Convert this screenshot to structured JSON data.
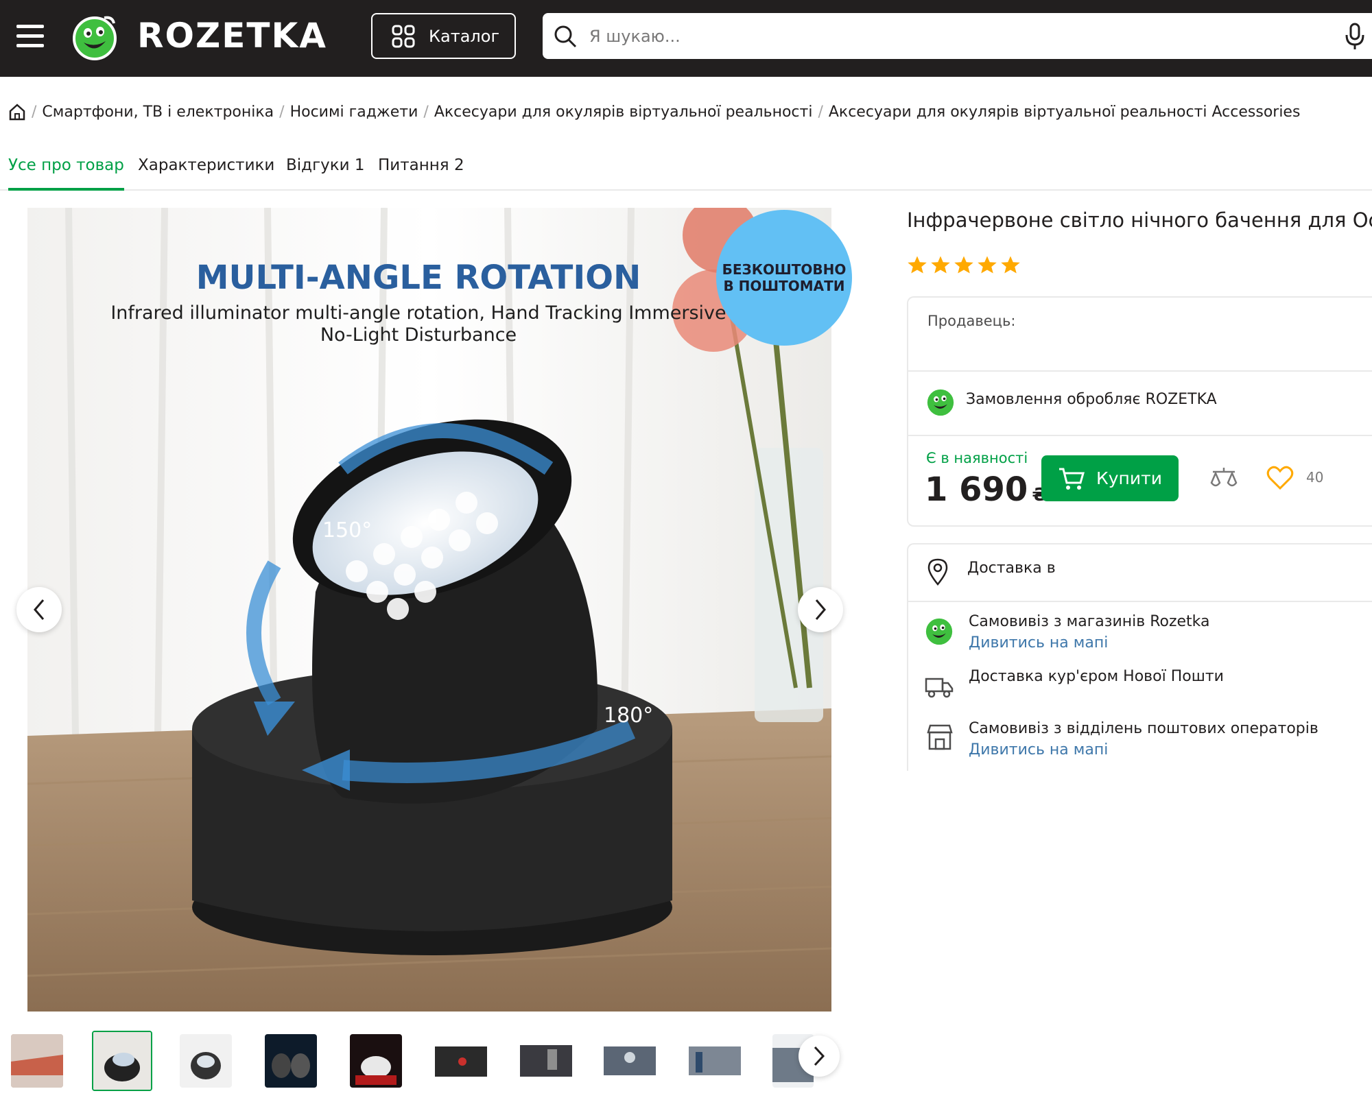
{
  "header": {
    "logo_text": "ROZETKA",
    "catalog_label": "Каталог",
    "search_placeholder": "Я шукаю..."
  },
  "breadcrumbs": [
    "Смартфони, ТВ і електроніка",
    "Носимі гаджети",
    "Аксесуари для окулярів віртуальної реальності",
    "Аксесуари для окулярів віртуальної реальності Accessories"
  ],
  "tabs": [
    "Усе про товар",
    "Характеристики",
    "Відгуки 1",
    "Питання 2"
  ],
  "gallery": {
    "headline": "MULTI-ANGLE ROTATION",
    "subline1": "Infrared illuminator multi-angle rotation, Hand Tracking Immersive",
    "subline2": "No-Light Disturbance",
    "angle1": "150°",
    "angle2": "180°",
    "badge_line1": "БЕЗКОШТОВНО",
    "badge_line2": "В ПОШТОМАТИ",
    "thumb_count": 10,
    "active_thumb": 2
  },
  "product": {
    "title": "Інфрачервоне світло нічного бачення для Oculus",
    "rating": 5,
    "seller_label": "Продавець:",
    "processed_by": "Замовлення обробляє ROZETKA",
    "availability": "Є в наявності",
    "price": "1 690",
    "currency": "₴",
    "buy_label": "Купити",
    "favorites_count": "40"
  },
  "delivery": {
    "title": "Доставка в",
    "items": [
      {
        "label": "Самовивіз з магазинів Rozetka",
        "link": "Дивитись на мапі"
      },
      {
        "label": "Доставка кур'єром Нової Пошти",
        "link": ""
      },
      {
        "label": "Самовивіз з відділень поштових операторів",
        "link": "Дивитись на мапі"
      }
    ]
  },
  "colors": {
    "header_bg": "#221f1f",
    "accent_green": "#00a046",
    "link_blue": "#3e77aa",
    "star": "#ffa900"
  }
}
